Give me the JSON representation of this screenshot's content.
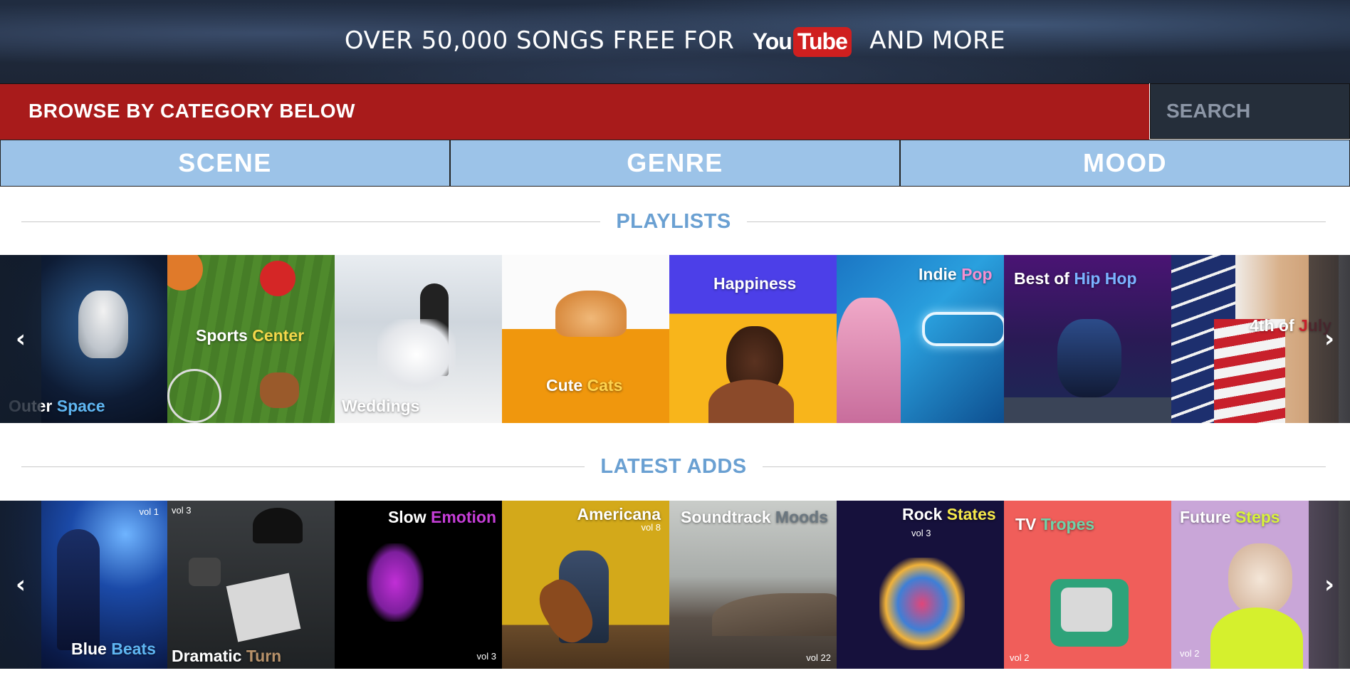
{
  "banner": {
    "text_before": "OVER 50,000 SONGS FREE FOR",
    "logo_you": "You",
    "logo_tube": "Tube",
    "text_after": "AND MORE"
  },
  "browse": {
    "label": "BROWSE BY CATEGORY BELOW"
  },
  "search": {
    "placeholder": "SEARCH"
  },
  "tabs": [
    {
      "label": "SCENE"
    },
    {
      "label": "GENRE"
    },
    {
      "label": "MOOD"
    }
  ],
  "playlists": {
    "heading": "PLAYLISTS",
    "tiles": [
      {
        "t1": "Outer",
        "t2": "Space",
        "accent": "#5fb6f2"
      },
      {
        "t1": "Sports",
        "t2": "Center",
        "accent": "#f4d84a"
      },
      {
        "t1": "Weddings",
        "t2": "",
        "accent": "#ffffff"
      },
      {
        "t1": "Cute",
        "t2": "Cats",
        "accent": "#ffd34d"
      },
      {
        "t1": "Happiness",
        "t2": "",
        "accent": "#ffffff"
      },
      {
        "t1": "Indie",
        "t2": "Pop",
        "accent": "#f58fd0"
      },
      {
        "t1": "Best of",
        "t2": "Hip Hop",
        "accent": "#7ab3ff"
      },
      {
        "t1": "4th of",
        "t2": "July",
        "accent": "#c8202b"
      }
    ]
  },
  "latest": {
    "heading": "LATEST ADDS",
    "tiles": [
      {
        "t1": "Blue",
        "t2": "Beats",
        "accent": "#5fb6f2",
        "vol": "vol 1"
      },
      {
        "t1": "Dramatic",
        "t2": "Turn",
        "accent": "#b8926a",
        "vol": "vol 3"
      },
      {
        "t1": "Slow",
        "t2": "Emotion",
        "accent": "#c43dd6",
        "vol": "vol 3"
      },
      {
        "t1": "Americana",
        "t2": "",
        "accent": "#ffffff",
        "vol": "vol 8"
      },
      {
        "t1": "Soundtrack",
        "t2": "Moods",
        "accent": "#6b7780",
        "vol": "vol 22"
      },
      {
        "t1": "Rock",
        "t2": "States",
        "accent": "#f5e84a",
        "vol": "vol 3"
      },
      {
        "t1": "TV",
        "t2": "Tropes",
        "accent": "#6fd2a8",
        "vol": "vol 2"
      },
      {
        "t1": "Future",
        "t2": "Steps",
        "accent": "#d8f33a",
        "vol": "vol 2"
      }
    ]
  },
  "icons": {
    "prev": "chevron-left-icon",
    "next": "chevron-right-icon"
  },
  "colors": {
    "red_bar": "#a81b1b",
    "tab_blue": "#9cc3e8",
    "heading_blue": "#6aa0d2",
    "youtube_red": "#cf1f1f"
  }
}
